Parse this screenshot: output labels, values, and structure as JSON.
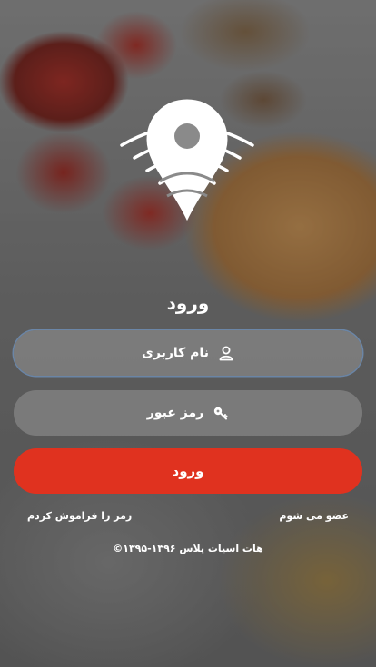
{
  "login": {
    "title": "ورود",
    "username_placeholder": "نام کاربری",
    "password_placeholder": "رمز عبور",
    "submit_label": "ورود",
    "forgot_password": "رمز را فراموش کردم",
    "signup": "عضو می شوم",
    "copyright": "©۱۳۹۵-۱۳۹۶ هات اسپات پلاس"
  },
  "icons": {
    "logo": "location-pin-wifi-icon",
    "username": "user-icon",
    "password": "key-icon"
  },
  "colors": {
    "accent": "#e0321f",
    "text": "#ffffff"
  }
}
